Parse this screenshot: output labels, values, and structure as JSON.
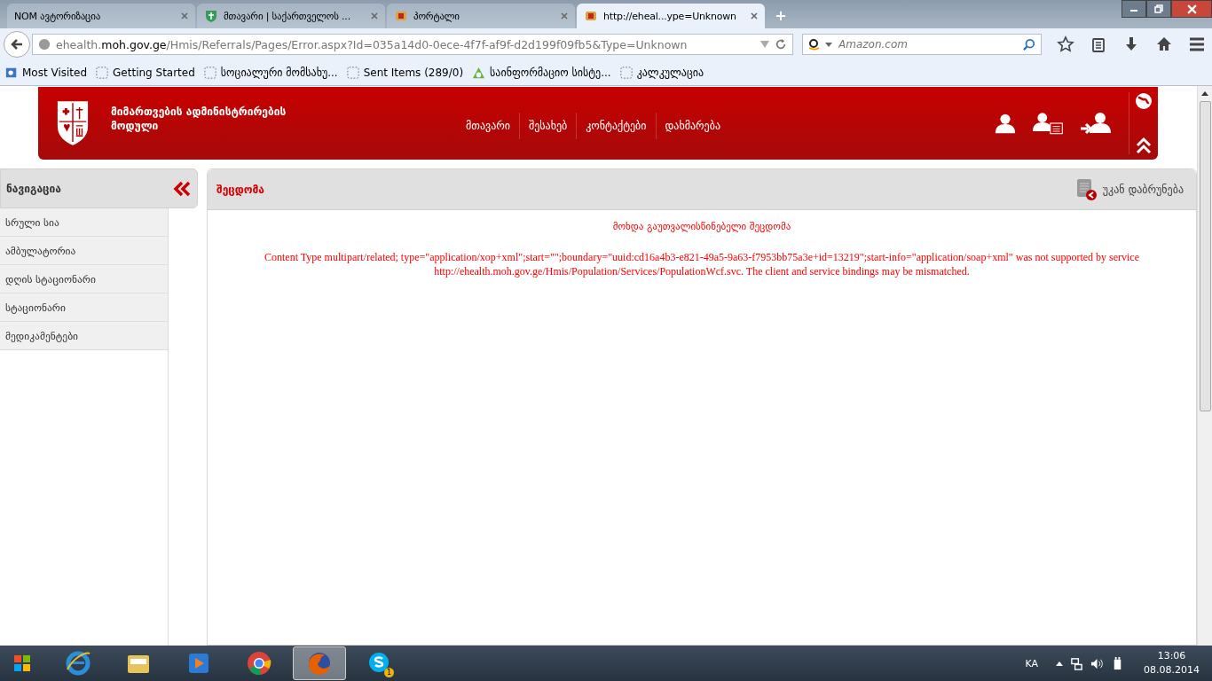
{
  "browser": {
    "tabs": [
      {
        "title": "NOM ავტორიზაცია",
        "kind": "blank",
        "selected": false
      },
      {
        "title": "მთავარი  | საქართველოს ...",
        "kind": "shield",
        "selected": false
      },
      {
        "title": "პორტალი",
        "kind": "crest",
        "selected": false
      },
      {
        "title": "http://eheal...ype=Unknown",
        "kind": "crest",
        "selected": true
      }
    ],
    "address": "ehealth.**moh.gov.ge**/Hmis/Referrals/Pages/Error.aspx?Id=035a14d0-0ece-4f7f-af9f-d2d199f09fb5&Type=Unknown",
    "search": {
      "placeholder": "Amazon.com"
    },
    "bookmarks": [
      {
        "label": "Most Visited",
        "kind": "app"
      },
      {
        "label": "Getting Started",
        "kind": "page"
      },
      {
        "label": "სოციალური მომსახუ...",
        "kind": "page"
      },
      {
        "label": "Sent Items (289/0)",
        "kind": "page"
      },
      {
        "label": "საინფორმაციო სისტე...",
        "kind": "leaf"
      },
      {
        "label": "კალკულაცია",
        "kind": "page"
      }
    ]
  },
  "site": {
    "title": "მიმართვების ადმინისტრირების მოდული",
    "nav": [
      "მთავარი",
      "შესახებ",
      "კონტაქტები",
      "დახმარება"
    ]
  },
  "sidebar": {
    "title": "ნავიგაცია",
    "items": [
      "სრული სია",
      "ამბულატორია",
      "დღის სტაციონარი",
      "სტაციონარი",
      "მედიკამენტები"
    ]
  },
  "panel": {
    "title": "შეცდომა",
    "back": "უკან დაბრუნება",
    "heading": "მოხდა გაუთვალისწინებელი შეცდომა",
    "message": "Content Type multipart/related; type=\"application/xop+xml\";start=\"\";boundary=\"uuid:cd16a4b3-e821-49a5-9a63-f7953bb75a3e+id=13219\";start-info=\"application/soap+xml\" was not supported by service http://ehealth.moh.gov.ge/Hmis/Population/Services/PopulationWcf.svc. The client and service bindings may be mismatched."
  },
  "taskbar": {
    "apps": [
      {
        "kind": "ie",
        "active": false
      },
      {
        "kind": "folder",
        "active": false
      },
      {
        "kind": "media",
        "active": false
      },
      {
        "kind": "chrome",
        "active": false
      },
      {
        "kind": "firefox",
        "active": true
      },
      {
        "kind": "skype",
        "active": false,
        "badge": "1"
      }
    ],
    "language": "KA",
    "time": "13:06",
    "date": "08.08.2014"
  }
}
